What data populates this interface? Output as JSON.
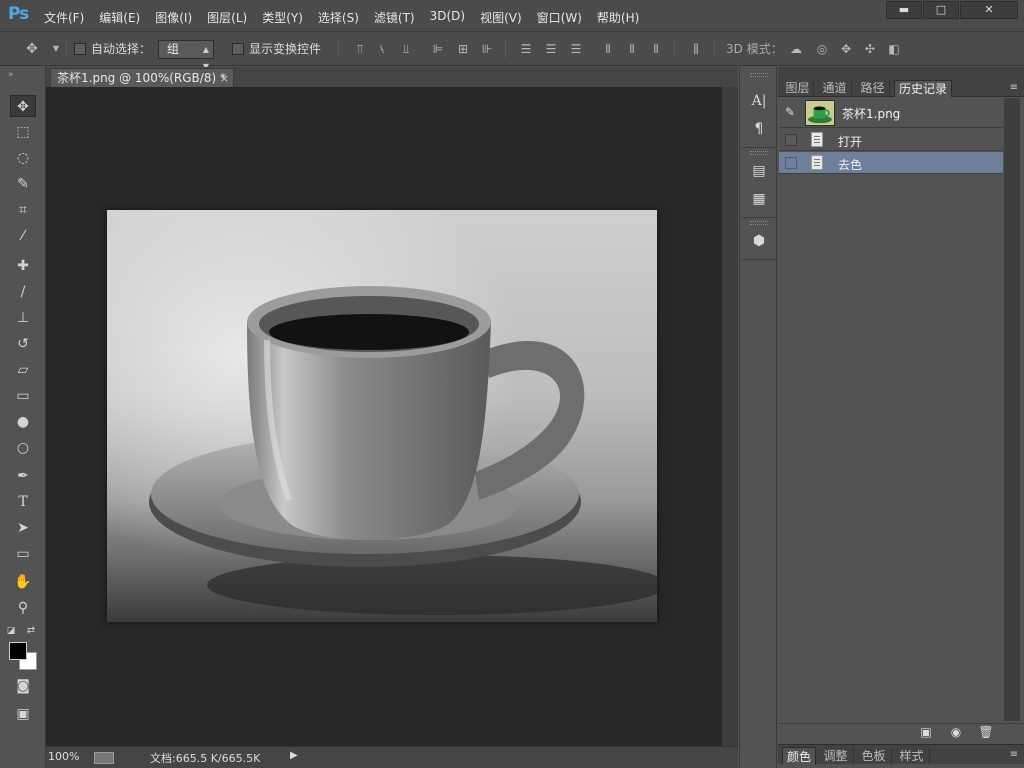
{
  "app": {
    "logo": "Ps",
    "menu": [
      "文件(F)",
      "编辑(E)",
      "图像(I)",
      "图层(L)",
      "类型(Y)",
      "选择(S)",
      "滤镜(T)",
      "3D(D)",
      "视图(V)",
      "窗口(W)",
      "帮助(H)"
    ],
    "window_controls": {
      "minimize": "▬",
      "maximize": "□",
      "close": "✕"
    }
  },
  "options_bar": {
    "auto_select_label": "自动选择：",
    "auto_select_checked": false,
    "group_value": "组",
    "show_transform_label": "显示变换控件",
    "show_transform_checked": false,
    "mode_3d_label": "3D 模式："
  },
  "document": {
    "tab_title": "茶杯1.png @ 100%(RGB/8) *",
    "tab_close": "×",
    "zoom": "100%",
    "doc_info": "文档:665.5 K/665.5K",
    "status_arrow": "▶"
  },
  "panels": {
    "top_tabs": [
      "图层",
      "通道",
      "路径",
      "历史记录"
    ],
    "active_tab": "历史记录",
    "snapshot_label": "茶杯1.png",
    "history": [
      {
        "label": "打开",
        "selected": false
      },
      {
        "label": "去色",
        "selected": true
      }
    ],
    "bottom_tabs": [
      "颜色",
      "调整",
      "色板",
      "样式"
    ],
    "bottom_active": "颜色"
  },
  "colors": {
    "foreground": "#000000",
    "background": "#ffffff",
    "history_selected": "#6d7f99",
    "ps_blue": "#4fa8e8"
  },
  "icons": {
    "tools": [
      "move-icon",
      "marquee-icon",
      "lasso-icon",
      "quick-select-icon",
      "crop-icon",
      "eyedropper-icon",
      "healing-icon",
      "brush-icon",
      "stamp-icon",
      "history-brush-icon",
      "eraser-icon",
      "gradient-icon",
      "blur-icon",
      "dodge-icon",
      "pen-icon",
      "type-icon",
      "path-select-icon",
      "shape-icon",
      "hand-icon",
      "zoom-icon"
    ],
    "dock": [
      "character-icon",
      "paragraph-icon",
      "note-icon",
      "comment-icon",
      "3d-box-icon"
    ]
  }
}
